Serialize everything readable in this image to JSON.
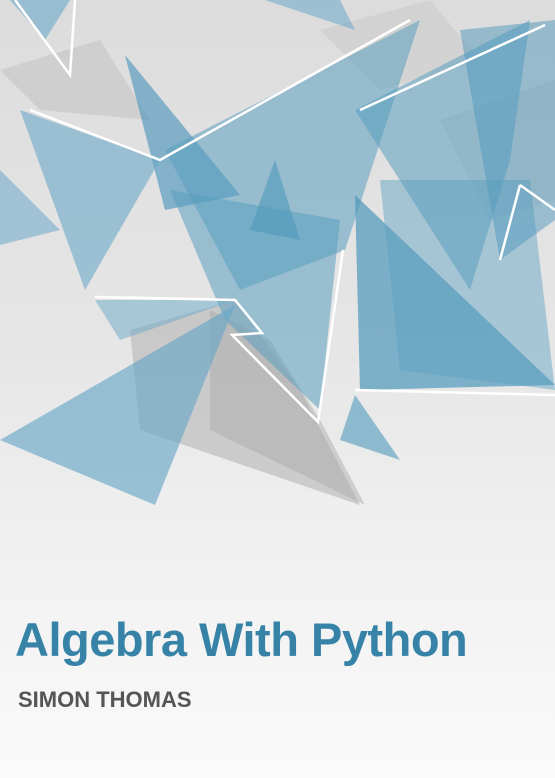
{
  "cover": {
    "title": "Algebra With Python",
    "author": "SIMON THOMAS"
  },
  "colors": {
    "title": "#3783a8",
    "author": "#555555",
    "shard_blue": "#5a9fc0",
    "shard_gray": "#b5b5b5",
    "background": "#ececec"
  }
}
